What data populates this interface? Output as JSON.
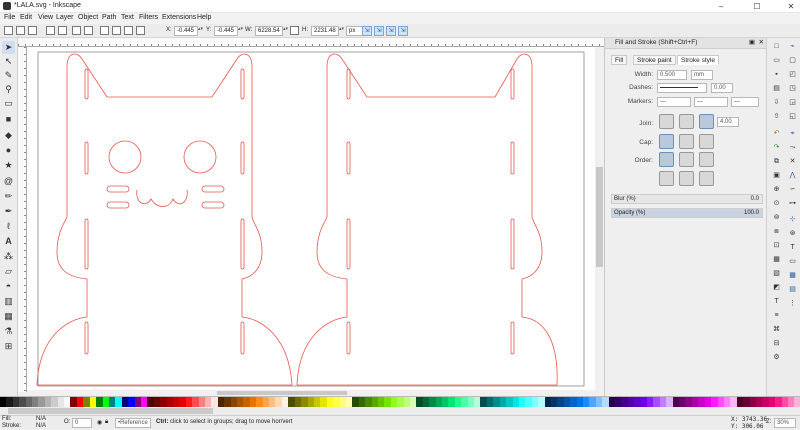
{
  "window": {
    "title": "*LALA.svg - Inkscape",
    "minimize": "–",
    "maximize": "☐",
    "close": "✕"
  },
  "menu": [
    "File",
    "Edit",
    "View",
    "Layer",
    "Object",
    "Path",
    "Text",
    "Filters",
    "Extensions",
    "Help"
  ],
  "controls": {
    "x_label": "X:",
    "x_value": "-0.445",
    "y_label": "Y:",
    "y_value": "-0.445",
    "w_label": "W:",
    "w_value": "6228.54",
    "h_label": "H:",
    "h_value": "2231.48",
    "unit": "px"
  },
  "dock": {
    "title": "Fill and Stroke (Shift+Ctrl+F)",
    "tabs": [
      "Fill",
      "Stroke paint",
      "Stroke style"
    ],
    "active_tab": "Stroke style",
    "width_label": "Width:",
    "width_value": "0.500",
    "width_unit": "mm",
    "dashes_label": "Dashes:",
    "dashes_value": "0.00",
    "markers_label": "Markers:",
    "join_label": "Join:",
    "join_value": "4.00",
    "cap_label": "Cap:",
    "order_label": "Order:",
    "blur_label": "Blur (%)",
    "blur_value": "0.0",
    "opacity_label": "Opacity (%)",
    "opacity_value": "100.0"
  },
  "status": {
    "fill_label": "Fill:",
    "fill_value": "N/A",
    "stroke_label": "Stroke:",
    "stroke_value": "N/A",
    "o_label": "O:",
    "o_value": "0",
    "layer_value": "•Reference",
    "message_bold": "Ctrl:",
    "message": "click to select in groups; drag to move hor/vert",
    "x_coord": "X: 3743.36",
    "y_coord": "Y:  306.06",
    "zoom_label": "Z:",
    "zoom_value": "30%"
  },
  "colors": {
    "canvas_stroke": "#e8554e",
    "snap_active": "#cde4f7",
    "palette": [
      "#000000",
      "#1a1a1a",
      "#333333",
      "#4d4d4d",
      "#666666",
      "#808080",
      "#999999",
      "#b3b3b3",
      "#cccccc",
      "#e6e6e6",
      "#ffffff",
      "#800000",
      "#ff0000",
      "#808000",
      "#ffff00",
      "#008000",
      "#00ff00",
      "#008080",
      "#00ffff",
      "#000080",
      "#0000ff",
      "#800080",
      "#ff00ff",
      "#4d0000",
      "#6b0000",
      "#8a0000",
      "#a80000",
      "#c70000",
      "#e60000",
      "#ff1a1a",
      "#ff4d4d",
      "#ff8080",
      "#ffb3b3",
      "#ffe6e6",
      "#4d2600",
      "#6b3500",
      "#8a4500",
      "#a85400",
      "#c76300",
      "#e67300",
      "#ff8c1a",
      "#ffa64d",
      "#ffbf80",
      "#ffd9b3",
      "#fff2e6",
      "#4d4d00",
      "#6b6b00",
      "#8a8a00",
      "#a8a800",
      "#c7c700",
      "#e6e600",
      "#ffff1a",
      "#ffff4d",
      "#ffff80",
      "#ffffb3",
      "#264d00",
      "#356b00",
      "#458a00",
      "#54a800",
      "#63c700",
      "#73e600",
      "#8cff1a",
      "#a6ff4d",
      "#bfff80",
      "#d9ffb3",
      "#004d26",
      "#006b35",
      "#008a45",
      "#00a854",
      "#00c763",
      "#00e673",
      "#1aff8c",
      "#4dffa6",
      "#80ffbf",
      "#b3ffd9",
      "#004d4d",
      "#006b6b",
      "#008a8a",
      "#00a8a8",
      "#00c7c7",
      "#00e6e6",
      "#1affff",
      "#4dffff",
      "#80ffff",
      "#b3ffff",
      "#00264d",
      "#00356b",
      "#00458a",
      "#0054a8",
      "#0063c7",
      "#0073e6",
      "#1a8cff",
      "#4da6ff",
      "#80bfff",
      "#b3d9ff",
      "#26004d",
      "#35006b",
      "#45008a",
      "#5400a8",
      "#6300c7",
      "#7300e6",
      "#8c1aff",
      "#a64dff",
      "#bf80ff",
      "#d9b3ff",
      "#4d004d",
      "#6b006b",
      "#8a008a",
      "#a800a8",
      "#c700c7",
      "#e600e6",
      "#ff1aff",
      "#ff4dff",
      "#ff80ff",
      "#ffb3ff",
      "#4d0026",
      "#6b0035",
      "#8a0045",
      "#a80054",
      "#c70063",
      "#e60073",
      "#ff1a8c",
      "#ff4da6",
      "#ff80bf",
      "#ffb3d9"
    ]
  }
}
